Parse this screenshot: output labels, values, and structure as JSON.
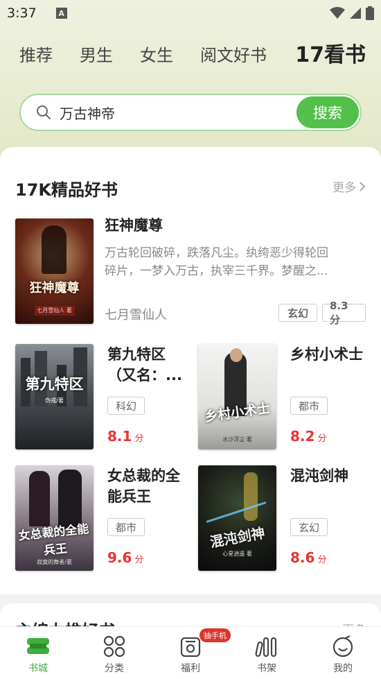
{
  "status": {
    "time": "3:37",
    "icon_a": "A"
  },
  "top_tabs": [
    "推荐",
    "男生",
    "女生",
    "阅文好书",
    "17看书"
  ],
  "search": {
    "value": "万古神帝",
    "button": "搜索"
  },
  "section": {
    "title": "17K精品好书",
    "more": "更多"
  },
  "featured": {
    "title": "狂神魔尊",
    "desc_line1": "万古轮回破碎，跌落凡尘。纨绔恶少得轮回",
    "desc_line2": "碎片，一梦入万古，执宰三千界。梦醒之...",
    "author": "七月雪仙人",
    "tag": "玄幻",
    "score": "8.3分",
    "cover_title": "狂神魔尊",
    "cover_author": "七月雪仙人 著"
  },
  "books": [
    {
      "title_line1": "第九特区",
      "title_line2": "（又名：...",
      "tag": "科幻",
      "score": "8.1",
      "unit": "分",
      "cover_title": "第九特区",
      "cover_author": "伪戒/著"
    },
    {
      "title_line1": "乡村小术士",
      "title_line2": "",
      "tag": "都市",
      "score": "8.2",
      "unit": "分",
      "cover_title": "乡村小术士",
      "cover_author": "水沙浮尘 著"
    },
    {
      "title_line1": "女总裁的全",
      "title_line2": "能兵王",
      "tag": "都市",
      "score": "9.6",
      "unit": "分",
      "cover_title": "女总裁的全能兵王",
      "cover_author": "寂寞的舞者/著"
    },
    {
      "title_line1": "混沌剑神",
      "title_line2": "",
      "tag": "玄幻",
      "score": "8.6",
      "unit": "分",
      "cover_title": "混沌剑神",
      "cover_author": "心星逍遥 著"
    }
  ],
  "section2": {
    "title": "主编力推好书",
    "more": "更多"
  },
  "nav": [
    {
      "label": "书城",
      "icon": "bookstore-icon"
    },
    {
      "label": "分类",
      "icon": "category-icon"
    },
    {
      "label": "福利",
      "icon": "welfare-icon",
      "badge": "抽手机"
    },
    {
      "label": "书架",
      "icon": "bookshelf-icon"
    },
    {
      "label": "我的",
      "icon": "profile-icon"
    }
  ],
  "colors": {
    "accent": "#52c04a",
    "score": "#e8352e",
    "nav_active": "#3fae3c"
  }
}
